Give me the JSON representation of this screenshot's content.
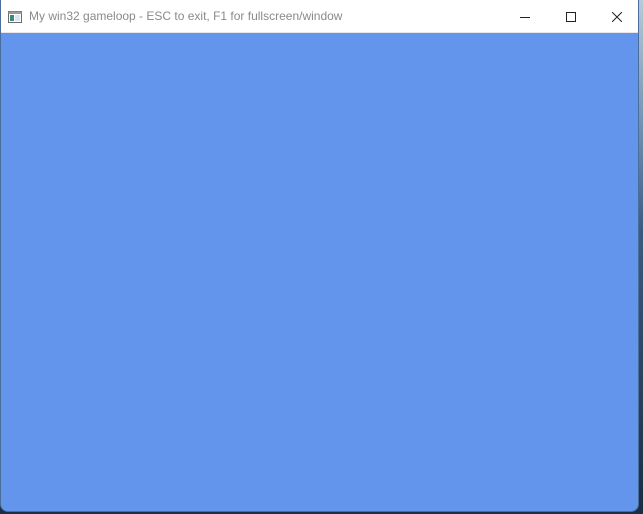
{
  "window": {
    "title": "My win32 gameloop - ESC to exit, F1 for fullscreen/window",
    "app_icon": "window-app-icon",
    "controls": {
      "minimize_icon": "minimize-icon",
      "maximize_icon": "maximize-icon",
      "close_icon": "close-icon"
    }
  },
  "client": {
    "background_color": "#6495ed"
  }
}
